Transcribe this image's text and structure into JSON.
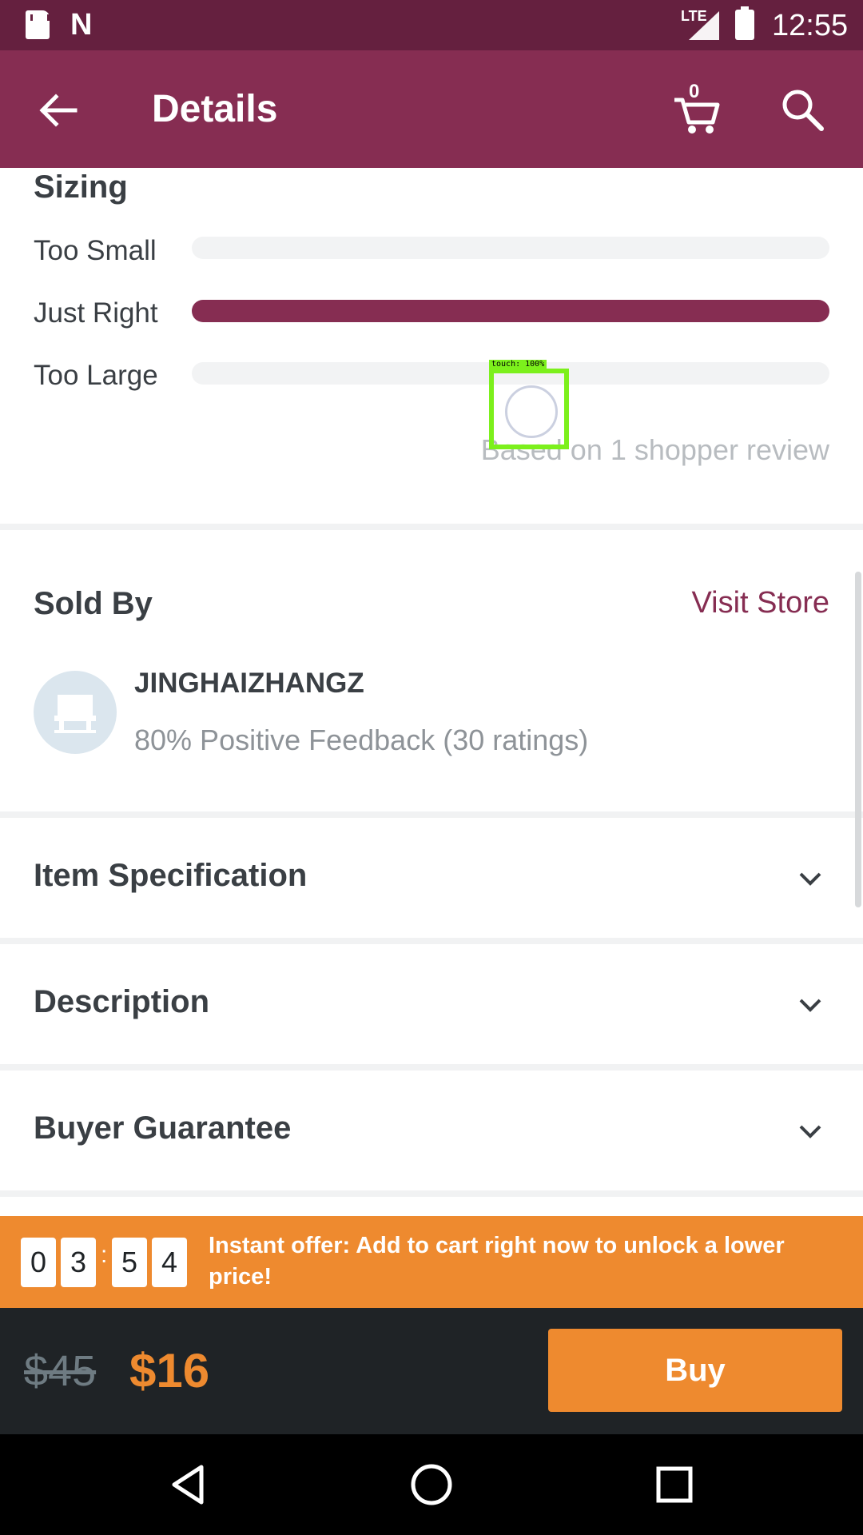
{
  "status_bar": {
    "time": "12:55",
    "network": "LTE"
  },
  "app_bar": {
    "title": "Details",
    "cart_count": "0"
  },
  "sizing": {
    "heading": "Sizing",
    "rows": [
      {
        "label": "Too Small",
        "fraction": 0
      },
      {
        "label": "Just Right",
        "fraction": 1
      },
      {
        "label": "Too Large",
        "fraction": 0
      }
    ],
    "review_note": "Based on 1 shopper review"
  },
  "sold_by": {
    "heading": "Sold By",
    "visit_store": "Visit Store",
    "store_name": "JINGHAIZHANGZ",
    "feedback": "80% Positive Feedback (30 ratings)"
  },
  "accordions": [
    "Item Specification",
    "Description",
    "Buyer Guarantee"
  ],
  "offer": {
    "countdown": [
      "0",
      "3",
      "5",
      "4"
    ],
    "separator": ":",
    "text": "Instant offer: Add to cart right now to unlock a lower price!"
  },
  "price": {
    "original": "$45",
    "current": "$16",
    "buy_label": "Buy"
  },
  "touch_overlay": {
    "label": "touch: 100%"
  },
  "colors": {
    "brand": "#862d52",
    "accent": "#ee8a2f",
    "status_bar": "#65203f"
  }
}
